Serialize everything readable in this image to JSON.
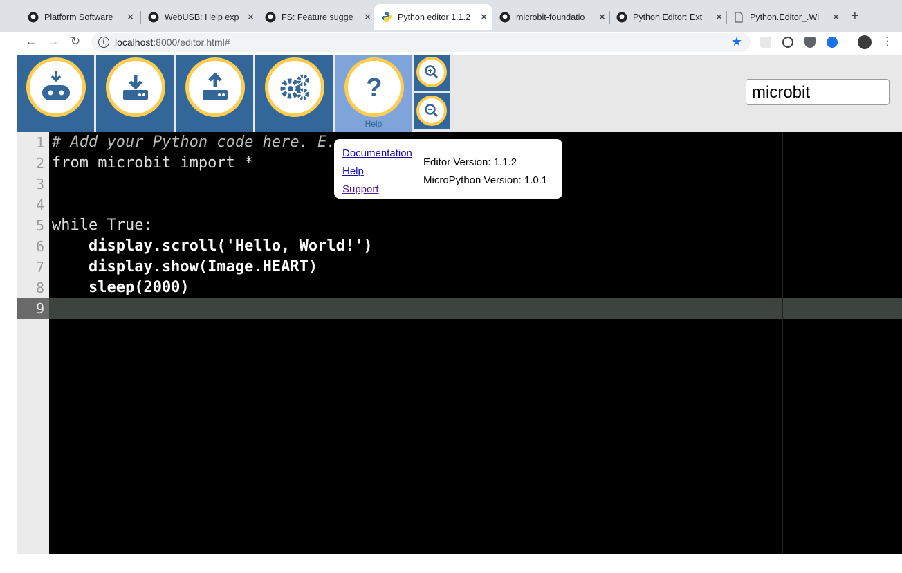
{
  "browser": {
    "tabs": [
      {
        "label": "Platform Software",
        "icon": "github-icon"
      },
      {
        "label": "WebUSB: Help exp",
        "icon": "github-icon"
      },
      {
        "label": "FS: Feature sugge",
        "icon": "github-icon"
      },
      {
        "label": "Python editor 1.1.2",
        "icon": "python-icon",
        "active": true
      },
      {
        "label": "microbit-foundatio",
        "icon": "github-icon"
      },
      {
        "label": "Python Editor: Ext",
        "icon": "github-icon"
      },
      {
        "label": "Python.Editor_.Wi",
        "icon": "document-icon"
      }
    ],
    "url_host": "localhost",
    "url_rest": ":8000/editor.html#"
  },
  "toolbar": {
    "buttons": [
      {
        "label": "Download",
        "icon": "microbit-download-icon"
      },
      {
        "label": "Save",
        "icon": "save-download-icon"
      },
      {
        "label": "Load",
        "icon": "upload-icon"
      },
      {
        "label": "Snippets",
        "icon": "gears-icon"
      },
      {
        "label": "Help",
        "icon": "question-icon"
      }
    ],
    "zoom_in": "zoom-in-icon",
    "zoom_out": "zoom-out-icon",
    "filename": "microbit"
  },
  "editor": {
    "line_numbers": [
      "1",
      "2",
      "3",
      "4",
      "5",
      "6",
      "7",
      "8",
      "9"
    ],
    "lines": [
      "# Add your Python code here. E.",
      "from microbit import *",
      "",
      "",
      "while True:",
      "    display.scroll('Hello, World!')",
      "    display.show(Image.HEART)",
      "    sleep(2000)",
      ""
    ]
  },
  "help_popup": {
    "links": [
      "Documentation",
      "Help",
      "Support"
    ],
    "editor_version": "Editor Version: 1.1.2",
    "micropython_version": "MicroPython Version: 1.0.1"
  },
  "colors": {
    "brand_blue": "#336699",
    "accent_yellow": "#fecc4e",
    "editor_bg": "#000000"
  }
}
